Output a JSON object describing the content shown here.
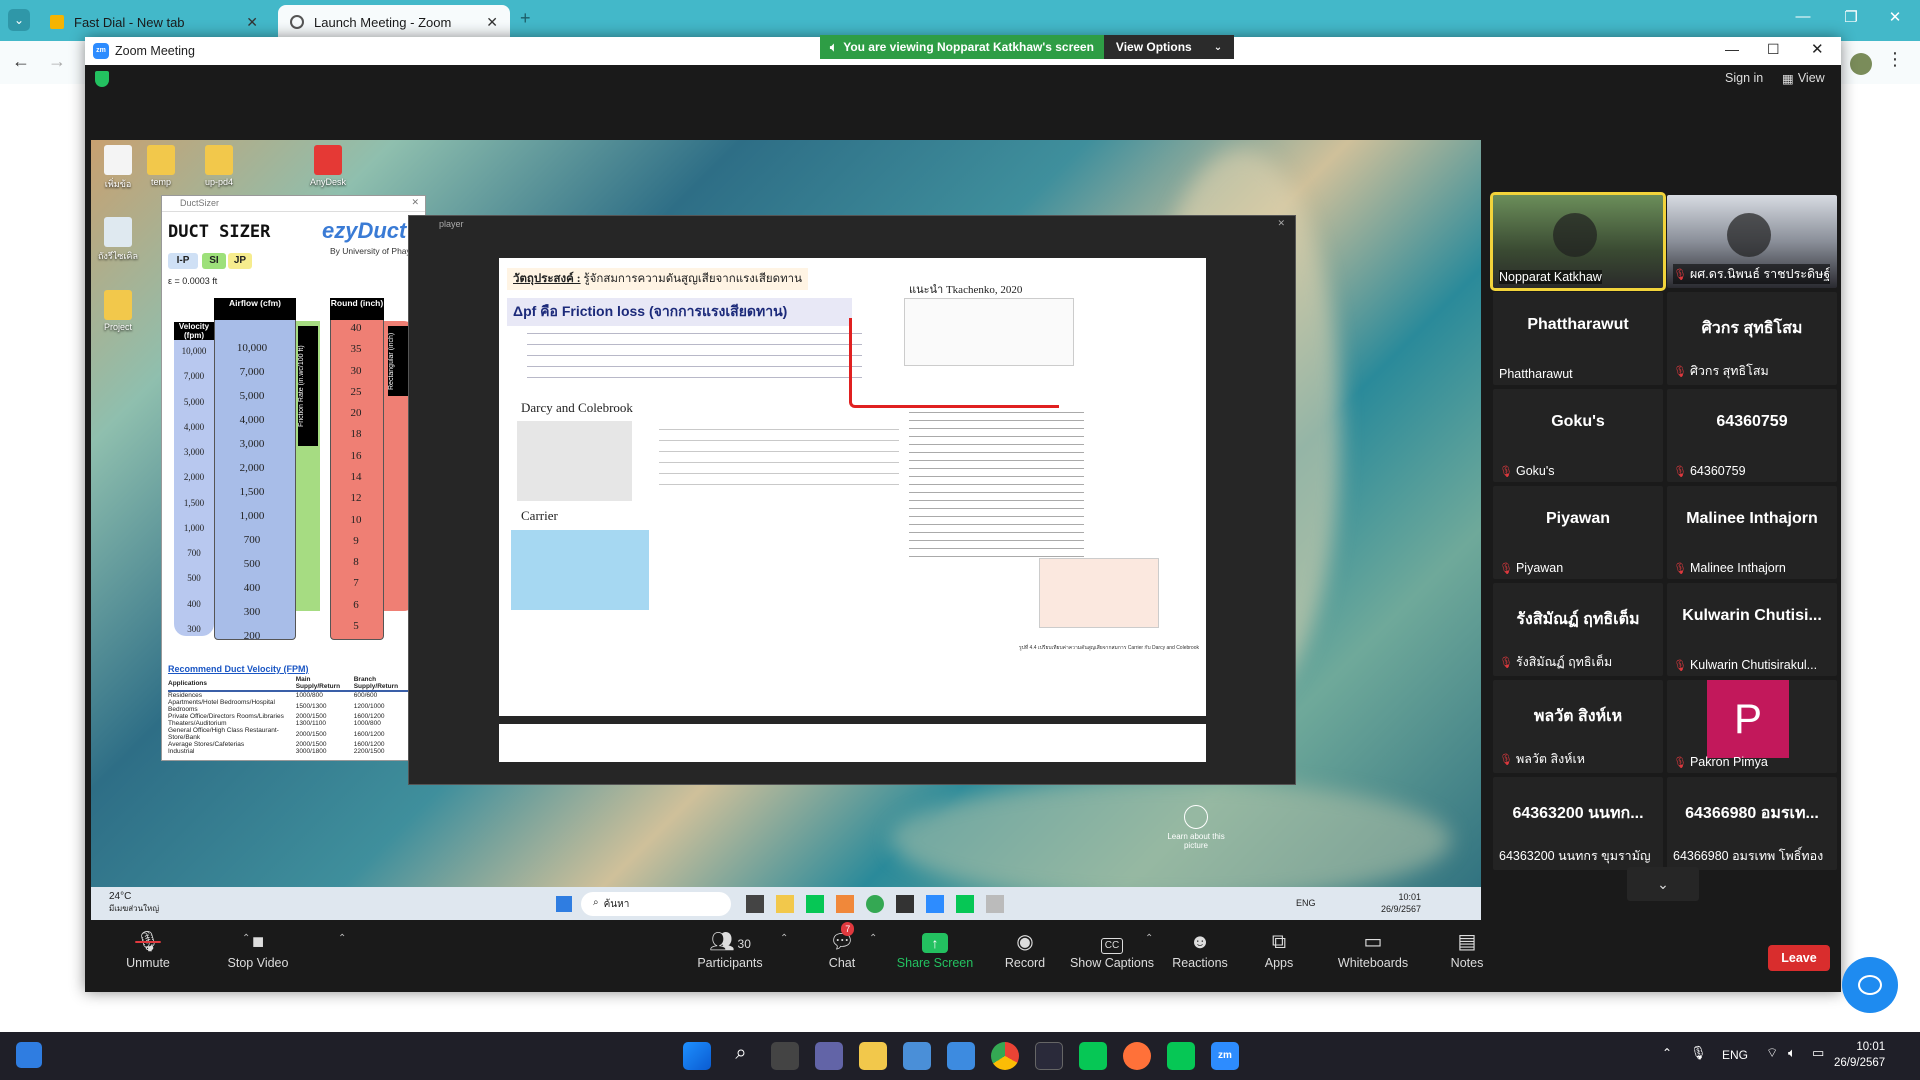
{
  "browser": {
    "tabs": [
      {
        "title": "Fast Dial - New tab",
        "active": false
      },
      {
        "title": "Launch Meeting - Zoom",
        "active": true
      }
    ]
  },
  "zoom": {
    "window_title": "Zoom Meeting",
    "share_banner": "You are viewing Nopparat Katkhaw's screen",
    "view_options": "View Options",
    "sign_in": "Sign in",
    "view": "View",
    "shared_screen": {
      "desktop_icons": [
        "เพิ่มข้อ",
        "temp",
        "up-pd4",
        "AnyDesk",
        "ถังรีไซเคิล",
        "Project"
      ],
      "ductsizer": {
        "title": "DuctSizer",
        "app_name": "DUCT SIZER",
        "brand": "ezyDuct",
        "byline": "By University of Phayao",
        "units": [
          "I-P",
          "SI",
          "JP"
        ],
        "epsilon": "ε = 0.0003 ft",
        "airflow": "Airflow (cfm)",
        "velocity": "Velocity (fpm)",
        "friction": "Friction Rate (in.wc/100 ft)",
        "round": "Round (inch)",
        "rect": "Rectangular (inch)",
        "velocity_ticks": [
          "10,000",
          "7,000",
          "5,000",
          "4,000",
          "3,000",
          "2,000",
          "1,500",
          "1,000",
          "700",
          "500",
          "400",
          "300"
        ],
        "airflow_ticks": [
          "10,000",
          "7,000",
          "5,000",
          "4,000",
          "3,000",
          "2,000",
          "1,500",
          "1,000",
          "700",
          "500",
          "400",
          "300",
          "200"
        ],
        "round_ticks": [
          "40",
          "35",
          "30",
          "25",
          "20",
          "18",
          "16",
          "14",
          "12",
          "10",
          "9",
          "8",
          "7",
          "6",
          "5"
        ],
        "recommend_link": "Recommend Duct Velocity (FPM)",
        "table_head": [
          "Applications",
          "Main Supply/Return",
          "Branch Supply/Return"
        ],
        "table_rows": [
          [
            "Residences",
            "1000/800",
            "600/600"
          ],
          [
            "Apartments/Hotel Bedrooms/Hospital Bedrooms",
            "1500/1300",
            "1200/1000"
          ],
          [
            "Private Office/Directors Rooms/Libraries",
            "2000/1500",
            "1600/1200"
          ],
          [
            "Theaters/Auditorium",
            "1300/1100",
            "1000/800"
          ],
          [
            "General Office/High Class Restaurant-Store/Bank",
            "2000/1500",
            "1600/1200"
          ],
          [
            "Average Stores/Cafeterias",
            "2000/1500",
            "1600/1200"
          ],
          [
            "Industrial",
            "3000/1800",
            "2200/1500"
          ]
        ]
      },
      "player": {
        "title": "player",
        "objective_label": "วัตถุประสงค์ :",
        "objective_text": "รู้จักสมการความดันสูญเสียจากแรงเสียดทาน",
        "friction_heading": "Δpf คือ Friction loss (จากการแรงเสียดทาน)",
        "darcy_heading": "Darcy and Colebrook",
        "carrier_heading": "Carrier",
        "ref": "แนะนำ Tkachenko, 2020",
        "caption": "รูปที่ 4.4 เปรียบเทียบค่าความดันสูญเสียจากสมการ Carrier กับ Darcy and Colebrook"
      },
      "inner_taskbar": {
        "weather_temp": "24°C",
        "weather_desc": "มีเมฆส่วนใหญ่",
        "search": "ค้นหา",
        "lang": "ENG",
        "time": "10:01",
        "date": "26/9/2567"
      },
      "learn_more": "Learn about this picture"
    },
    "participants": [
      {
        "display": "",
        "name": "Nopparat Katkhaw",
        "muted": false,
        "video": true,
        "active_speaker": true
      },
      {
        "display": "",
        "name": "ผศ.ดร.นิพนธ์ ราชประดิษฐ์",
        "muted": true,
        "video": true
      },
      {
        "display": "Phattharawut",
        "name": "Phattharawut",
        "muted": false
      },
      {
        "display": "ศิวกร สุทธิโสม",
        "name": "ศิวกร สุทธิโสม",
        "muted": true
      },
      {
        "display": "Goku's",
        "name": "Goku's",
        "muted": true
      },
      {
        "display": "64360759",
        "name": "64360759",
        "muted": true
      },
      {
        "display": "Piyawan",
        "name": "Piyawan",
        "muted": true
      },
      {
        "display": "Malinee Inthajorn",
        "name": "Malinee Inthajorn",
        "muted": true
      },
      {
        "display": "รังสิมัณฏ์ ฤทธิเต็ม",
        "name": "รังสิมัณฏ์ ฤทธิเต็ม",
        "muted": true
      },
      {
        "display": "Kulwarin  Chutisi...",
        "name": "Kulwarin Chutisirakul...",
        "muted": true
      },
      {
        "display": "พลวัต สิงห์เห",
        "name": "พลวัต สิงห์เห",
        "muted": true
      },
      {
        "display": "P",
        "name": "Pakron Pimya",
        "muted": true,
        "avatar": true
      },
      {
        "display": "64363200 นนทก...",
        "name": "64363200 นนทกร ขุมรามัญ",
        "muted": false
      },
      {
        "display": "64366980 อมรเท...",
        "name": "64366980 อมรเทพ โพธิ์ทอง",
        "muted": false
      }
    ],
    "toolbar": {
      "unmute": "Unmute",
      "stop_video": "Stop Video",
      "participants": "Participants",
      "participants_count": "30",
      "chat": "Chat",
      "chat_badge": "7",
      "share_screen": "Share Screen",
      "record": "Record",
      "show_captions": "Show Captions",
      "reactions": "Reactions",
      "apps": "Apps",
      "whiteboards": "Whiteboards",
      "notes": "Notes",
      "leave": "Leave"
    }
  },
  "taskbar": {
    "lang": "ENG",
    "time": "10:01",
    "date": "26/9/2567"
  },
  "colors": {
    "browser_accent": "#43b8c9",
    "banner_green": "#2e9d45",
    "share_green": "#23c160",
    "leave_red": "#d92d2d",
    "speaker_yellow": "#f2d43b"
  }
}
